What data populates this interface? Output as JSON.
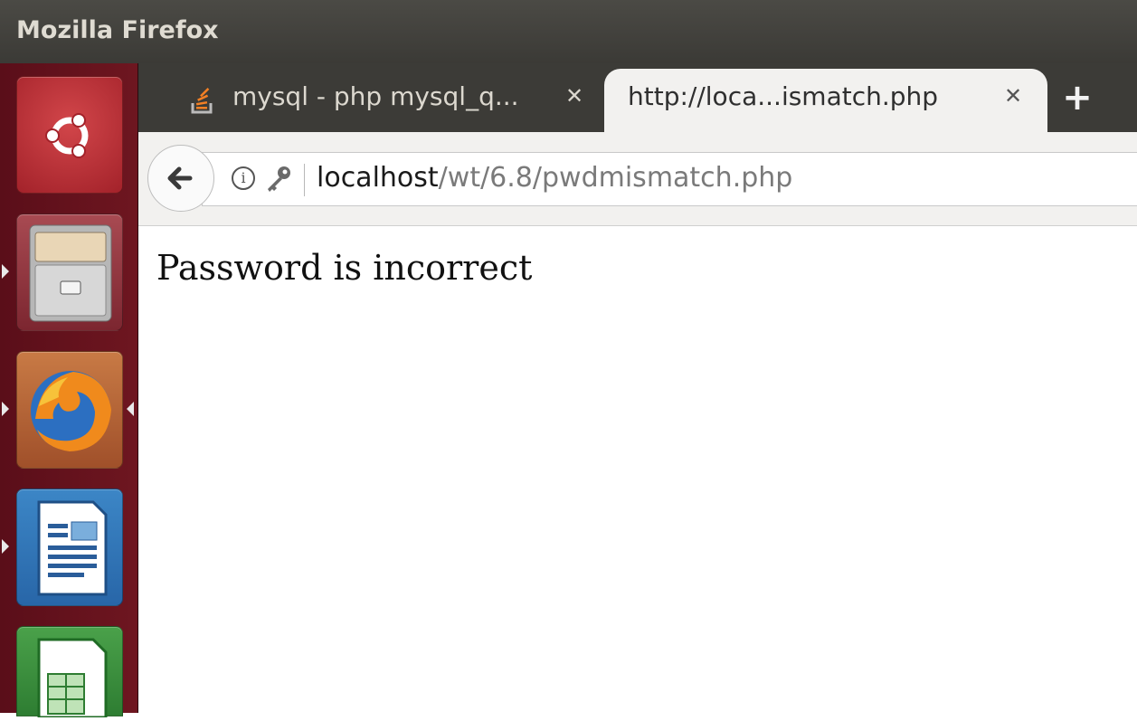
{
  "window": {
    "title": "Mozilla Firefox"
  },
  "tabs": [
    {
      "label": "mysql - php mysql_q...",
      "icon": "stackoverflow-icon",
      "active": false
    },
    {
      "label": "http://loca...ismatch.php",
      "active": true
    }
  ],
  "urlbar": {
    "host": "localhost",
    "path": "/wt/6.8/pwdmismatch.php"
  },
  "page": {
    "message": "Password is incorrect"
  },
  "launcher": {
    "items": [
      "ubuntu-dash-icon",
      "files-icon",
      "firefox-icon",
      "writer-icon",
      "calc-icon"
    ]
  },
  "colors": {
    "titlebar": "#3b3a36",
    "launcher": "#5a0e19",
    "tab_active": "#f2f1ef"
  }
}
